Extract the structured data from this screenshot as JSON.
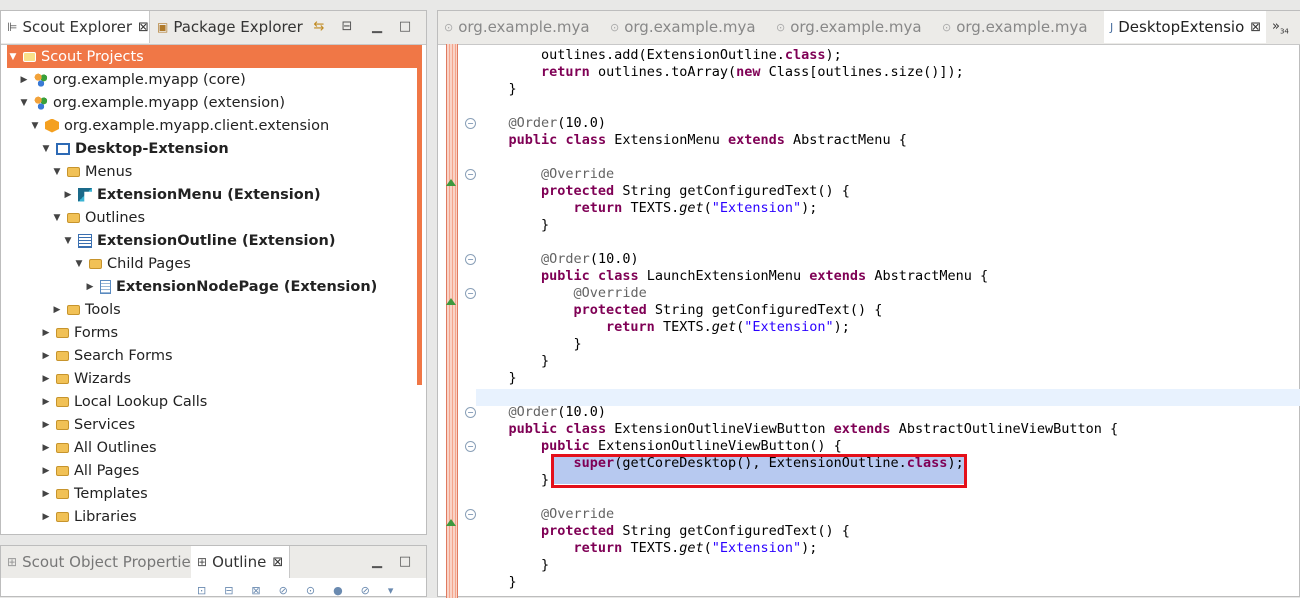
{
  "left_panel": {
    "tabs": [
      {
        "label": "Scout Explorer",
        "icon": "scout-explorer-icon",
        "active": true
      },
      {
        "label": "Package Explorer",
        "icon": "package-explorer-icon",
        "active": false
      }
    ],
    "tree": [
      {
        "label": "Scout Projects",
        "level": 0,
        "expanded": true,
        "icon": "folder-open-icon",
        "bold": false,
        "selected": true
      },
      {
        "label": "org.example.myapp (core)",
        "level": 1,
        "expanded": false,
        "icon": "project-icon",
        "bold": false
      },
      {
        "label": "org.example.myapp (extension)",
        "level": 1,
        "expanded": true,
        "icon": "project-icon",
        "bold": false
      },
      {
        "label": "org.example.myapp.client.extension",
        "level": 2,
        "expanded": true,
        "icon": "bundle-icon",
        "bold": false
      },
      {
        "label": "Desktop-Extension",
        "level": 3,
        "expanded": true,
        "icon": "desktop-icon",
        "bold": true
      },
      {
        "label": "Menus",
        "level": 4,
        "expanded": true,
        "icon": "folder-open-icon",
        "bold": false
      },
      {
        "label": "ExtensionMenu (Extension)",
        "level": 5,
        "expanded": false,
        "icon": "menu-icon",
        "bold": true
      },
      {
        "label": "Outlines",
        "level": 4,
        "expanded": true,
        "icon": "folder-open-icon",
        "bold": false
      },
      {
        "label": "ExtensionOutline (Extension)",
        "level": 5,
        "expanded": true,
        "icon": "outline-icon",
        "bold": true
      },
      {
        "label": "Child Pages",
        "level": 6,
        "expanded": true,
        "icon": "folder-open-icon",
        "bold": false
      },
      {
        "label": "ExtensionNodePage (Extension)",
        "level": 7,
        "expanded": false,
        "icon": "page-icon",
        "bold": true
      },
      {
        "label": "Tools",
        "level": 4,
        "expanded": false,
        "icon": "folder-icon",
        "bold": false
      },
      {
        "label": "Forms",
        "level": 3,
        "expanded": false,
        "icon": "folder-icon",
        "bold": false
      },
      {
        "label": "Search Forms",
        "level": 3,
        "expanded": false,
        "icon": "folder-icon",
        "bold": false
      },
      {
        "label": "Wizards",
        "level": 3,
        "expanded": false,
        "icon": "folder-icon",
        "bold": false
      },
      {
        "label": "Local Lookup Calls",
        "level": 3,
        "expanded": false,
        "icon": "folder-icon",
        "bold": false
      },
      {
        "label": "Services",
        "level": 3,
        "expanded": false,
        "icon": "folder-icon",
        "bold": false
      },
      {
        "label": "All Outlines",
        "level": 3,
        "expanded": false,
        "icon": "folder-icon",
        "bold": false
      },
      {
        "label": "All Pages",
        "level": 3,
        "expanded": false,
        "icon": "folder-icon",
        "bold": false
      },
      {
        "label": "Templates",
        "level": 3,
        "expanded": false,
        "icon": "folder-icon",
        "bold": false
      },
      {
        "label": "Libraries",
        "level": 3,
        "expanded": false,
        "icon": "folder-icon",
        "bold": false
      }
    ]
  },
  "bottom_left_panel": {
    "tabs": [
      {
        "label": "Scout Object Properties",
        "active": false
      },
      {
        "label": "Outline",
        "active": true
      }
    ]
  },
  "editor": {
    "tabs": [
      {
        "label": "org.example.mya",
        "active": false
      },
      {
        "label": "org.example.mya",
        "active": false
      },
      {
        "label": "org.example.mya",
        "active": false
      },
      {
        "label": "org.example.mya",
        "active": false
      },
      {
        "label": "DesktopExtensio",
        "active": true
      }
    ],
    "overflow_label": "»",
    "overflow_count": "34",
    "code_lines": [
      [
        {
          "t": "        outlines.add(ExtensionOutline."
        },
        {
          "t": "class",
          "c": "kw"
        },
        {
          "t": ");"
        }
      ],
      [
        {
          "t": "        "
        },
        {
          "t": "return",
          "c": "kw"
        },
        {
          "t": " outlines.toArray("
        },
        {
          "t": "new",
          "c": "kw"
        },
        {
          "t": " Class[outlines.size()]);"
        }
      ],
      [
        {
          "t": "    }"
        }
      ],
      [
        {
          "t": ""
        }
      ],
      [
        {
          "t": "    "
        },
        {
          "t": "@Order",
          "c": "ann"
        },
        {
          "t": "(10.0)"
        }
      ],
      [
        {
          "t": "    "
        },
        {
          "t": "public",
          "c": "kw"
        },
        {
          "t": " "
        },
        {
          "t": "class",
          "c": "kw"
        },
        {
          "t": " ExtensionMenu "
        },
        {
          "t": "extends",
          "c": "kw"
        },
        {
          "t": " AbstractMenu {"
        }
      ],
      [
        {
          "t": ""
        }
      ],
      [
        {
          "t": "        "
        },
        {
          "t": "@Override",
          "c": "ann"
        }
      ],
      [
        {
          "t": "        "
        },
        {
          "t": "protected",
          "c": "kw"
        },
        {
          "t": " String getConfiguredText() {"
        }
      ],
      [
        {
          "t": "            "
        },
        {
          "t": "return",
          "c": "kw"
        },
        {
          "t": " TEXTS."
        },
        {
          "t": "get",
          "c": "it"
        },
        {
          "t": "("
        },
        {
          "t": "\"Extension\"",
          "c": "str"
        },
        {
          "t": ");"
        }
      ],
      [
        {
          "t": "        }"
        }
      ],
      [
        {
          "t": ""
        }
      ],
      [
        {
          "t": "        "
        },
        {
          "t": "@Order",
          "c": "ann"
        },
        {
          "t": "(10.0)"
        }
      ],
      [
        {
          "t": "        "
        },
        {
          "t": "public",
          "c": "kw"
        },
        {
          "t": " "
        },
        {
          "t": "class",
          "c": "kw"
        },
        {
          "t": " LaunchExtensionMenu "
        },
        {
          "t": "extends",
          "c": "kw"
        },
        {
          "t": " AbstractMenu {"
        }
      ],
      [
        {
          "t": "            "
        },
        {
          "t": "@Override",
          "c": "ann"
        }
      ],
      [
        {
          "t": "            "
        },
        {
          "t": "protected",
          "c": "kw"
        },
        {
          "t": " String getConfiguredText() {"
        }
      ],
      [
        {
          "t": "                "
        },
        {
          "t": "return",
          "c": "kw"
        },
        {
          "t": " TEXTS."
        },
        {
          "t": "get",
          "c": "it"
        },
        {
          "t": "("
        },
        {
          "t": "\"Extension\"",
          "c": "str"
        },
        {
          "t": ");"
        }
      ],
      [
        {
          "t": "            }"
        }
      ],
      [
        {
          "t": "        }"
        }
      ],
      [
        {
          "t": "    }"
        }
      ],
      [
        {
          "t": ""
        }
      ],
      [
        {
          "t": "    "
        },
        {
          "t": "@Order",
          "c": "ann"
        },
        {
          "t": "(10.0)"
        }
      ],
      [
        {
          "t": "    "
        },
        {
          "t": "public",
          "c": "kw"
        },
        {
          "t": " "
        },
        {
          "t": "class",
          "c": "kw"
        },
        {
          "t": " ExtensionOutlineViewButton "
        },
        {
          "t": "extends",
          "c": "kw"
        },
        {
          "t": " AbstractOutlineViewButton {"
        }
      ],
      [
        {
          "t": "        "
        },
        {
          "t": "public",
          "c": "kw"
        },
        {
          "t": " ExtensionOutlineViewButton() {"
        }
      ],
      [
        {
          "t": "            "
        },
        {
          "t": "super",
          "c": "kw"
        },
        {
          "t": "(getCoreDesktop(), ExtensionOutline."
        },
        {
          "t": "class",
          "c": "kw"
        },
        {
          "t": ");"
        }
      ],
      [
        {
          "t": "        }"
        }
      ],
      [
        {
          "t": ""
        }
      ],
      [
        {
          "t": "        "
        },
        {
          "t": "@Override",
          "c": "ann"
        }
      ],
      [
        {
          "t": "        "
        },
        {
          "t": "protected",
          "c": "kw"
        },
        {
          "t": " String getConfiguredText() {"
        }
      ],
      [
        {
          "t": "            "
        },
        {
          "t": "return",
          "c": "kw"
        },
        {
          "t": " TEXTS."
        },
        {
          "t": "get",
          "c": "it"
        },
        {
          "t": "("
        },
        {
          "t": "\"Extension\"",
          "c": "str"
        },
        {
          "t": ");"
        }
      ],
      [
        {
          "t": "        }"
        }
      ],
      [
        {
          "t": "    }"
        }
      ]
    ]
  },
  "colors": {
    "selection": "#f07746",
    "highlight_box": "#e4101a",
    "keyword": "#7f0055",
    "string": "#2a00ff"
  }
}
